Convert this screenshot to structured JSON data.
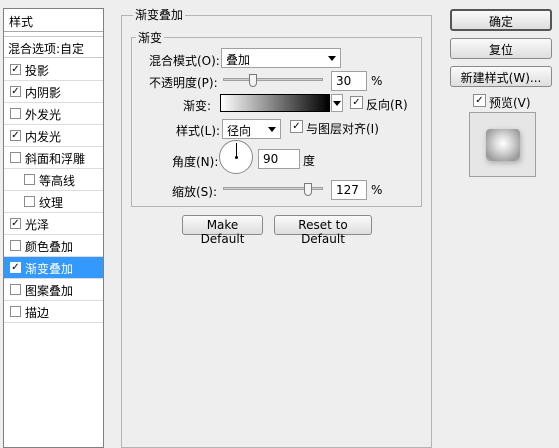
{
  "sidebar": {
    "header": "样式",
    "blend_options": "混合选项:自定",
    "items": [
      {
        "label": "投影",
        "checked": true,
        "sub": false,
        "selected": false
      },
      {
        "label": "内阴影",
        "checked": true,
        "sub": false,
        "selected": false
      },
      {
        "label": "外发光",
        "checked": false,
        "sub": false,
        "selected": false
      },
      {
        "label": "内发光",
        "checked": true,
        "sub": false,
        "selected": false
      },
      {
        "label": "斜面和浮雕",
        "checked": false,
        "sub": false,
        "selected": false
      },
      {
        "label": "等高线",
        "checked": false,
        "sub": true,
        "selected": false
      },
      {
        "label": "纹理",
        "checked": false,
        "sub": true,
        "selected": false
      },
      {
        "label": "光泽",
        "checked": true,
        "sub": false,
        "selected": false
      },
      {
        "label": "颜色叠加",
        "checked": false,
        "sub": false,
        "selected": false
      },
      {
        "label": "渐变叠加",
        "checked": true,
        "sub": false,
        "selected": true
      },
      {
        "label": "图案叠加",
        "checked": false,
        "sub": false,
        "selected": false
      },
      {
        "label": "描边",
        "checked": false,
        "sub": false,
        "selected": false
      }
    ]
  },
  "panel": {
    "outer_title": "渐变叠加",
    "inner_title": "渐变",
    "blend_mode": {
      "label": "混合模式(O):",
      "value": "叠加"
    },
    "opacity": {
      "label": "不透明度(P):",
      "value": "30",
      "unit": "%",
      "level": 0.3
    },
    "gradient": {
      "label": "渐变:",
      "reverse_label": "反向(R)",
      "reverse_checked": true
    },
    "style": {
      "label": "样式(L):",
      "value": "径向",
      "align_label": "与图层对齐(I)",
      "align_checked": true
    },
    "angle": {
      "label": "角度(N):",
      "value": "90",
      "unit": "度"
    },
    "scale": {
      "label": "缩放(S):",
      "value": "127",
      "unit": "%",
      "level": 0.85
    },
    "make_default": "Make Default",
    "reset_default": "Reset to Default"
  },
  "actions": {
    "ok": "确定",
    "reset": "复位",
    "new_style": "新建样式(W)...",
    "preview_label": "预览(V)",
    "preview_checked": true
  },
  "check_glyph": "✓"
}
